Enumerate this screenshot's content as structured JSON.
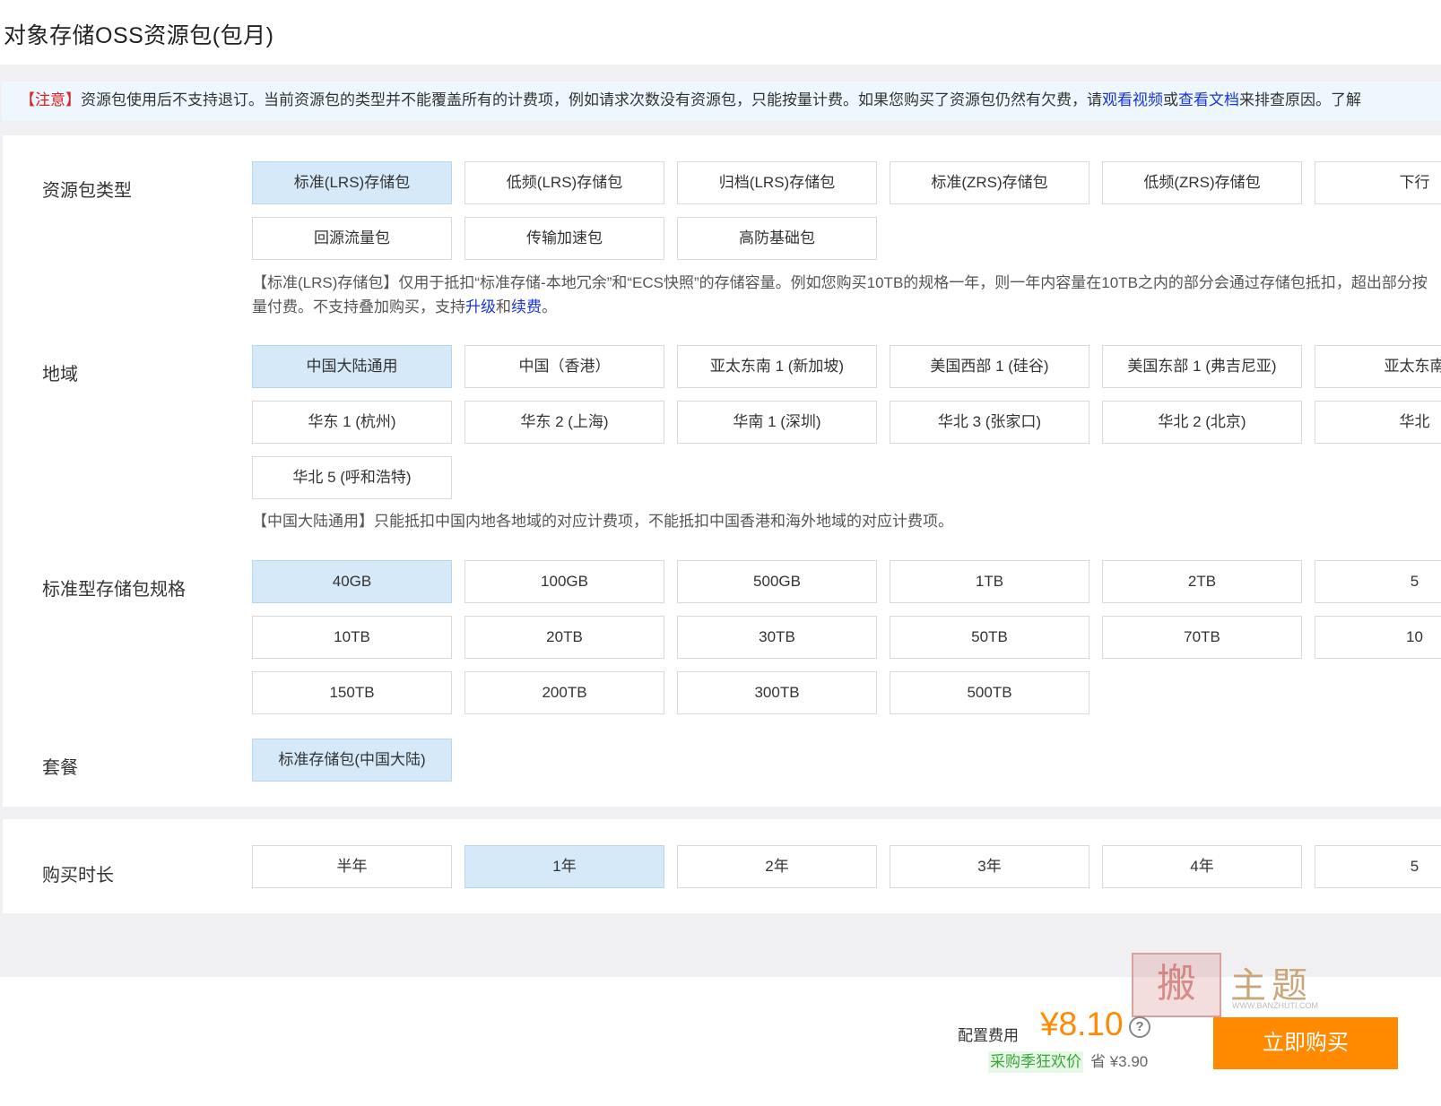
{
  "title": "对象存储OSS资源包(包月)",
  "notice": {
    "tag": "【注意】",
    "text1": "资源包使用后不支持退订。当前资源包的类型并不能覆盖所有的计费项，例如请求次数没有资源包，只能按量计费。如果您购买了资源包仍然有欠费，请",
    "link1": "观看视频",
    "text2": "或",
    "link2": "查看文档",
    "text3": "来排查原因。了解"
  },
  "package_type": {
    "label": "资源包类型",
    "options": [
      "标准(LRS)存储包",
      "低频(LRS)存储包",
      "归档(LRS)存储包",
      "标准(ZRS)存储包",
      "低频(ZRS)存储包",
      "下行",
      "回源流量包",
      "传输加速包",
      "高防基础包"
    ],
    "selected": "标准(LRS)存储包",
    "desc_text": "【标准(LRS)存储包】仅用于抵扣“标准存储-本地冗余”和“ECS快照”的存储容量。例如您购买10TB的规格一年，则一年内容量在10TB之内的部分会通过存储包抵扣，超出部分按量付费。不支持叠加购买，支持",
    "desc_link1": "升级",
    "desc_and": "和",
    "desc_link2": "续费",
    "desc_end": "。"
  },
  "region": {
    "label": "地域",
    "options": [
      "中国大陆通用",
      "中国（香港）",
      "亚太东南 1 (新加坡)",
      "美国西部 1 (硅谷)",
      "美国东部 1 (弗吉尼亚)",
      "亚太东南",
      "华东 1 (杭州)",
      "华东 2 (上海)",
      "华南 1 (深圳)",
      "华北 3 (张家口)",
      "华北 2 (北京)",
      "华北",
      "华北 5 (呼和浩特)"
    ],
    "selected": "中国大陆通用",
    "desc": "【中国大陆通用】只能抵扣中国内地各地域的对应计费项，不能抵扣中国香港和海外地域的对应计费项。"
  },
  "spec": {
    "label": "标准型存储包规格",
    "options": [
      "40GB",
      "100GB",
      "500GB",
      "1TB",
      "2TB",
      "5",
      "10TB",
      "20TB",
      "30TB",
      "50TB",
      "70TB",
      "10",
      "150TB",
      "200TB",
      "300TB",
      "500TB"
    ],
    "selected": "40GB"
  },
  "plan": {
    "label": "套餐",
    "options": [
      "标准存储包(中国大陆)"
    ],
    "selected": "标准存储包(中国大陆)"
  },
  "duration": {
    "label": "购买时长",
    "options": [
      "半年",
      "1年",
      "2年",
      "3年",
      "4年",
      "5"
    ],
    "selected": "1年"
  },
  "footer": {
    "fee_label": "配置费用",
    "price": "¥8.10",
    "help_glyph": "?",
    "promo": "采购季狂欢价",
    "save_text": "省 ¥3.90",
    "buy_label": "立即购买"
  },
  "watermark": {
    "seal_text": "搬",
    "text": "主题",
    "url": "WWW.BANZHUTI.COM"
  },
  "colors": {
    "accent": "#ff8a00",
    "selected_bg": "#d6e9f8",
    "link": "#1a35d6",
    "notice_tag": "#e02020",
    "promo_green": "#3aa63a"
  },
  "icons": {
    "help": "question-circle-icon"
  }
}
